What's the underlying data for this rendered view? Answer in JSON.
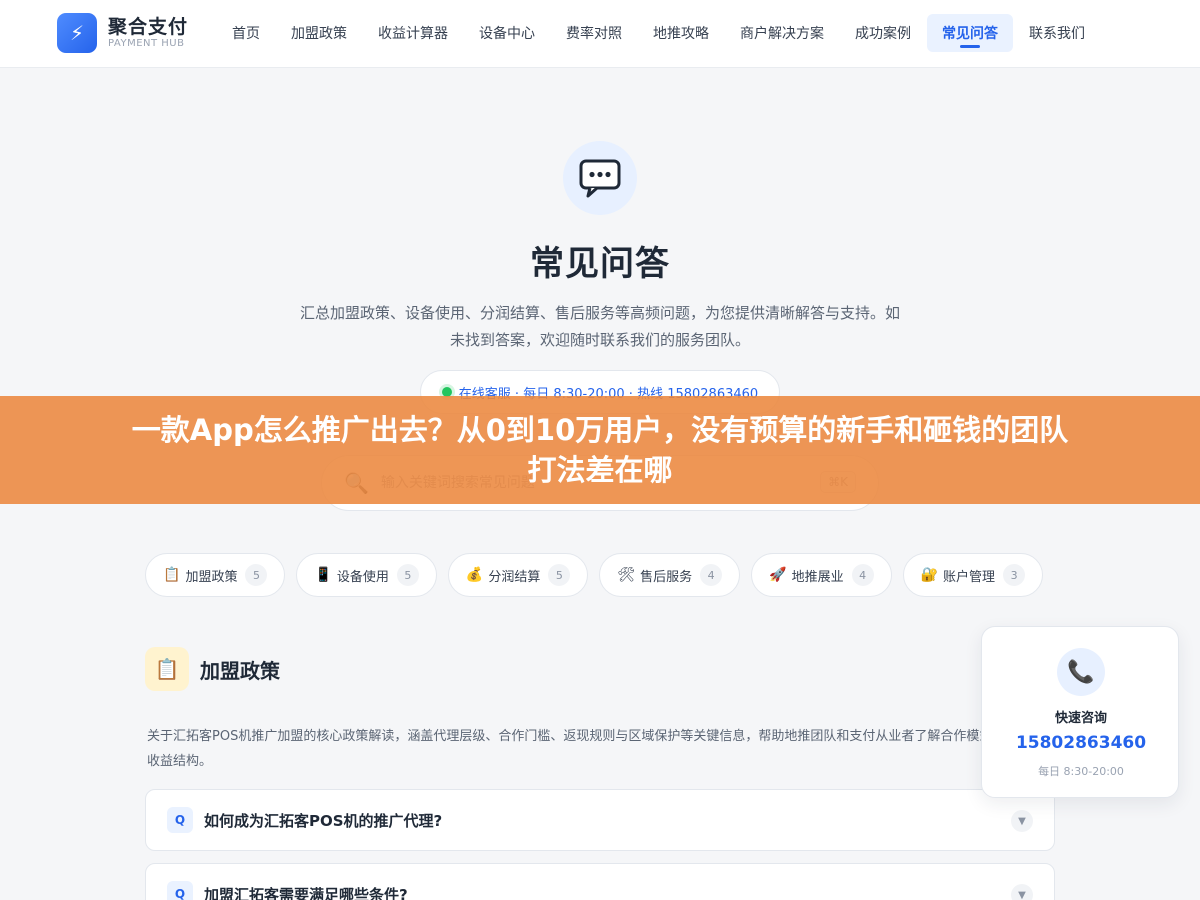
{
  "header": {
    "logo_title": "聚合支付",
    "logo_sub": "PAYMENT HUB",
    "logo_icon": "lightning-icon",
    "nav": [
      {
        "label": "首页",
        "active": false
      },
      {
        "label": "加盟政策",
        "active": false
      },
      {
        "label": "收益计算器",
        "active": false
      },
      {
        "label": "设备中心",
        "active": false
      },
      {
        "label": "费率对照",
        "active": false
      },
      {
        "label": "地推攻略",
        "active": false
      },
      {
        "label": "商户解决方案",
        "active": false
      },
      {
        "label": "成功案例",
        "active": false
      },
      {
        "label": "常见问答",
        "active": true
      },
      {
        "label": "联系我们",
        "active": false
      }
    ]
  },
  "hero": {
    "icon": "chat-bubble-icon",
    "title": "常见问答",
    "desc": "汇总加盟政策、设备使用、分润结算、售后服务等高频问题，为您提供清晰解答与支持。如未找到答案，欢迎随时联系我们的服务团队。",
    "contact": "在线客服 · 每日 8:30-20:00 · 热线 15802863460"
  },
  "search": {
    "placeholder": "输入关键词搜索常见问题",
    "shortcut": "⌘K"
  },
  "banner": {
    "line1": "一款App怎么推广出去？从0到10万用户，没有预算的新手和砸钱的团队",
    "line2": "打法差在哪"
  },
  "categories": [
    {
      "icon": "📋",
      "label": "加盟政策",
      "count": "5"
    },
    {
      "icon": "📱",
      "label": "设备使用",
      "count": "5"
    },
    {
      "icon": "💰",
      "label": "分润结算",
      "count": "5"
    },
    {
      "icon": "🛠",
      "label": "售后服务",
      "count": "4"
    },
    {
      "icon": "🚀",
      "label": "地推展业",
      "count": "4"
    },
    {
      "icon": "🔐",
      "label": "账户管理",
      "count": "3"
    }
  ],
  "section": {
    "icon": "📋",
    "title": "加盟政策",
    "desc": "关于汇拓客POS机推广加盟的核心政策解读，涵盖代理层级、合作门槛、返现规则与区域保护等关键信息，帮助地推团队和支付从业者了解合作模式与收益结构。"
  },
  "faqs": [
    {
      "badge": "Q",
      "question": "如何成为汇拓客POS机的推广代理?"
    },
    {
      "badge": "Q",
      "question": "加盟汇拓客需要满足哪些条件?"
    }
  ],
  "float_card": {
    "icon": "📞",
    "label": "快速咨询",
    "phone": "15802863460",
    "hours": "每日 8:30-20:00"
  },
  "colors": {
    "accent": "#2563eb",
    "banner": "#ec873e",
    "online": "#22c55e"
  }
}
